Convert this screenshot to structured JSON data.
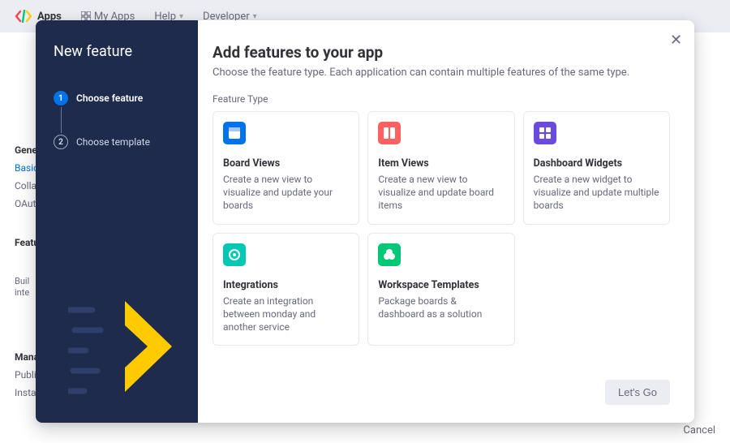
{
  "bg": {
    "logo": "Apps",
    "nav": {
      "my_apps": "My Apps",
      "help": "Help",
      "developer": "Developer"
    },
    "sidebar": {
      "general_section": "General",
      "basic": "Basic",
      "collab": "Collab",
      "oauth": "OAuth",
      "features_section": "Featu",
      "build_hint_l1": "Buil",
      "build_hint_l2": "inte",
      "manage_section": "Manag",
      "publish": "Publis",
      "install": "Install"
    },
    "footer_cancel": "Cancel"
  },
  "modal": {
    "panel_title": "New feature",
    "steps": [
      {
        "num": "1",
        "label": "Choose feature"
      },
      {
        "num": "2",
        "label": "Choose template"
      }
    ],
    "title": "Add features to your app",
    "subtitle": "Choose the feature type. Each application can contain multiple features of the same type.",
    "group_label": "Feature Type",
    "cards": [
      {
        "id": "board-views",
        "title": "Board Views",
        "desc": "Create a new view to visualize and update your boards",
        "color": "#0073ea"
      },
      {
        "id": "item-views",
        "title": "Item Views",
        "desc": "Create a new view to visualize and update board items",
        "color": "#ff6161"
      },
      {
        "id": "dashboard-widgets",
        "title": "Dashboard Widgets",
        "desc": "Create a new widget to visualize and update multiple boards",
        "color": "#6c4ae0"
      },
      {
        "id": "integrations",
        "title": "Integrations",
        "desc": "Create an integration between monday and another service",
        "color": "#00c8b4"
      },
      {
        "id": "workspace-templates",
        "title": "Workspace Templates",
        "desc": "Package boards & dashboard as a solution",
        "color": "#00c875"
      }
    ],
    "go_label": "Let's Go"
  }
}
